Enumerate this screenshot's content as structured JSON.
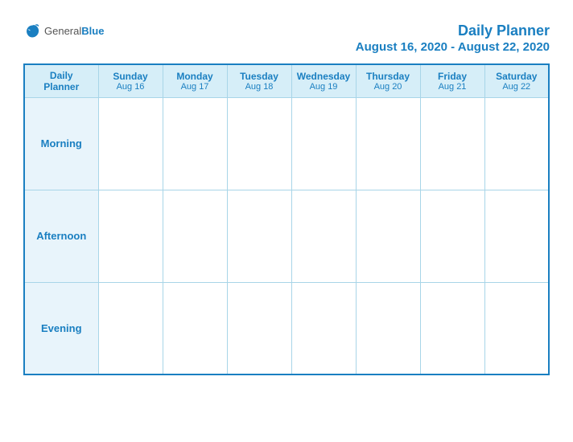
{
  "header": {
    "logo": {
      "general": "General",
      "blue": "Blue"
    },
    "title": "Daily Planner",
    "dates": "August 16, 2020 - August 22, 2020"
  },
  "table": {
    "columns": [
      {
        "day": "Daily Planner",
        "date": ""
      },
      {
        "day": "Sunday",
        "date": "Aug 16"
      },
      {
        "day": "Monday",
        "date": "Aug 17"
      },
      {
        "day": "Tuesday",
        "date": "Aug 18"
      },
      {
        "day": "Wednesday",
        "date": "Aug 19"
      },
      {
        "day": "Thursday",
        "date": "Aug 20"
      },
      {
        "day": "Friday",
        "date": "Aug 21"
      },
      {
        "day": "Saturday",
        "date": "Aug 22"
      }
    ],
    "rows": [
      {
        "label": "Morning"
      },
      {
        "label": "Afternoon"
      },
      {
        "label": "Evening"
      }
    ]
  }
}
